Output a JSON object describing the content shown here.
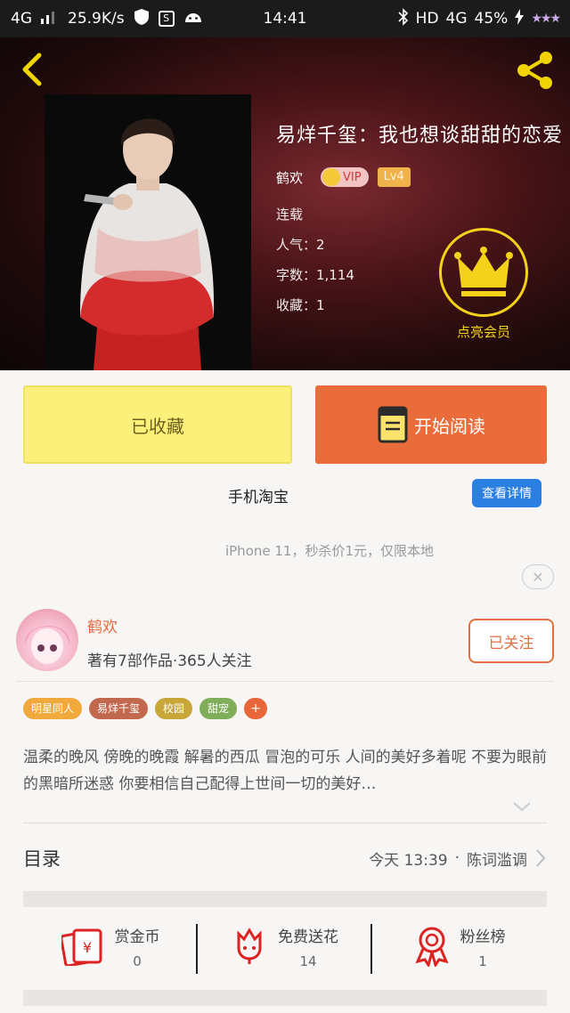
{
  "status_bar": {
    "network": "4G",
    "speed": "25.9K/s",
    "time": "14:41",
    "right_network": "HD",
    "right_net2": "4G",
    "battery": "45%"
  },
  "book": {
    "title": "易烊千玺：我也想谈甜甜的恋爱",
    "author": "鹤欢",
    "vip_label": "VIP",
    "level": "Lv4",
    "status": "连载",
    "popularity": "人气：2",
    "word_count": "字数：1,114",
    "favorites": "收藏：1",
    "vip_light_label": "点亮会员"
  },
  "actions": {
    "collected_label": "已收藏",
    "read_label": "开始阅读"
  },
  "ad": {
    "title": "手机淘宝",
    "button": "查看详情",
    "description": "iPhone 11，秒杀价1元，仅限本地",
    "close": "✕"
  },
  "author_card": {
    "name": "鹤欢",
    "stats": "著有7部作品·365人关注",
    "follow_label": "已关注"
  },
  "tags": [
    {
      "label": "明星同人",
      "color": "#f0a93a"
    },
    {
      "label": "易烊千玺",
      "color": "#c2684f"
    },
    {
      "label": "校园",
      "color": "#c8a63a"
    },
    {
      "label": "甜宠",
      "color": "#7fae5a"
    },
    {
      "label": "+",
      "color": "#e8663a"
    }
  ],
  "synopsis": "温柔的晚风 傍晚的晚霞 解暑的西瓜 冒泡的可乐 人间的美好多着呢 不要为眼前的黑暗所迷惑 你要相信自己配得上世间一切的美好…",
  "toc": {
    "label": "目录",
    "latest_time": "今天 13:39",
    "dot": "·",
    "latest_chapter": "陈词滥调"
  },
  "stats": [
    {
      "label": "赏金币",
      "value": "0",
      "icon": "red-envelope-icon"
    },
    {
      "label": "免费送花",
      "value": "14",
      "icon": "flower-icon"
    },
    {
      "label": "粉丝榜",
      "value": "1",
      "icon": "medal-icon"
    }
  ],
  "colors": {
    "accent_orange": "#ea6c3a",
    "collect_yellow": "#fbf07a",
    "vip_gold": "#f5d21a",
    "ad_blue": "#2a7fe0"
  }
}
